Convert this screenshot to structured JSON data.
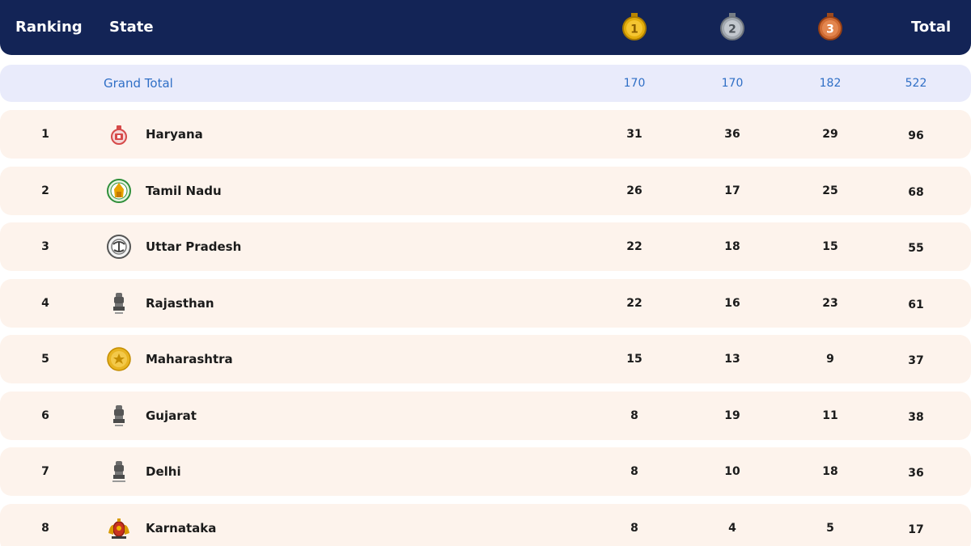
{
  "header": {
    "ranking_label": "Ranking",
    "state_label": "State",
    "total_label": "Total",
    "medals": [
      {
        "icon": "gold-medal-icon",
        "label": "1",
        "color": "#d9a300"
      },
      {
        "icon": "silver-medal-icon",
        "label": "2",
        "color": "#8f969e"
      },
      {
        "icon": "bronze-medal-icon",
        "label": "3",
        "color": "#c4622e"
      }
    ]
  },
  "grand_total": {
    "label": "Grand Total",
    "gold": "170",
    "silver": "170",
    "bronze": "182",
    "total": "522"
  },
  "rows": [
    {
      "rank": "1",
      "state": "Haryana",
      "emblem": "haryana-emblem-icon",
      "gold": "31",
      "silver": "36",
      "bronze": "29",
      "total": "96"
    },
    {
      "rank": "2",
      "state": "Tamil Nadu",
      "emblem": "tamil-nadu-emblem-icon",
      "gold": "26",
      "silver": "17",
      "bronze": "25",
      "total": "68"
    },
    {
      "rank": "3",
      "state": "Uttar Pradesh",
      "emblem": "uttar-pradesh-emblem-icon",
      "gold": "22",
      "silver": "18",
      "bronze": "15",
      "total": "55"
    },
    {
      "rank": "4",
      "state": "Rajasthan",
      "emblem": "rajasthan-emblem-icon",
      "gold": "22",
      "silver": "16",
      "bronze": "23",
      "total": "61"
    },
    {
      "rank": "5",
      "state": "Maharashtra",
      "emblem": "maharashtra-emblem-icon",
      "gold": "15",
      "silver": "13",
      "bronze": "9",
      "total": "37"
    },
    {
      "rank": "6",
      "state": "Gujarat",
      "emblem": "gujarat-emblem-icon",
      "gold": "8",
      "silver": "19",
      "bronze": "11",
      "total": "38"
    },
    {
      "rank": "7",
      "state": "Delhi",
      "emblem": "delhi-emblem-icon",
      "gold": "8",
      "silver": "10",
      "bronze": "18",
      "total": "36"
    },
    {
      "rank": "8",
      "state": "Karnataka",
      "emblem": "karnataka-emblem-icon",
      "gold": "8",
      "silver": "4",
      "bronze": "5",
      "total": "17"
    }
  ],
  "colors": {
    "header_bg": "#132456",
    "grand_bg": "#e9ebfb",
    "grand_text": "#2f6fc6",
    "row_bg": "#fdf3ec"
  }
}
